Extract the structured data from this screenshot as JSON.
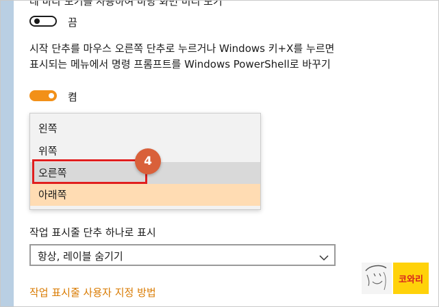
{
  "top_cut_text": "테 바다 보기를 사용하여 바탕 화면 미리 보기",
  "toggle_peek": {
    "state_label": "끔",
    "on": false
  },
  "setting_description": "시작 단추를 마우스 오른쪽 단추로 누르거나 Windows 키+X를 누르면 표시되는 메뉴에서 명령 프롬프트를 Windows PowerShell로 바꾸기",
  "toggle_powershell": {
    "state_label": "켬",
    "on": true
  },
  "taskbar_location_dropdown": {
    "options": [
      "왼쪽",
      "위쪽",
      "오른쪽",
      "아래쪽"
    ],
    "hovered": "오른쪽",
    "selected": "아래쪽"
  },
  "step_badge": "4",
  "combine_buttons": {
    "label": "작업 표시줄 단추 하나로 표시",
    "value": "항상, 레이블 숨기기"
  },
  "customize_link": "작업 표시줄 사용자 지정 방법",
  "logo": {
    "text": "코와리"
  },
  "colors": {
    "accent_orange": "#f29018",
    "highlight_red": "#e01e1e",
    "selected_option": "#ffdcb3",
    "link": "#d97a00",
    "logo_yellow": "#ffd20a"
  }
}
